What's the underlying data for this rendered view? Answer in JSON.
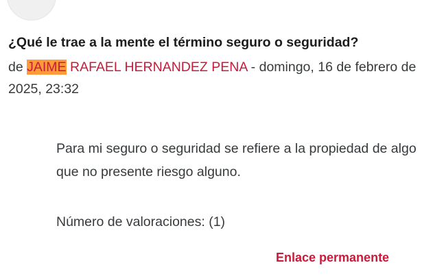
{
  "post": {
    "subject": "¿Qué le trae a la mente el término seguro o seguridad?",
    "byline_prefix": "de",
    "author_first_highlighted": "JAIME",
    "author_rest": "RAFAEL HERNANDEZ PENA",
    "date_separator": "-",
    "date": "domingo, 16 de febrero de 2025, 23:32",
    "message": "Para mi seguro o seguridad se refiere a la propiedad de algo que no presente riesgo alguno.",
    "ratings_label": "Número de valoraciones:",
    "ratings_count": "(1)",
    "permalink_label": "Enlace permanente"
  },
  "colors": {
    "link": "#ca1a3a",
    "highlight": "#ff9a3c",
    "text": "#373a3c"
  },
  "icons": {
    "avatar": "user-avatar-placeholder"
  }
}
